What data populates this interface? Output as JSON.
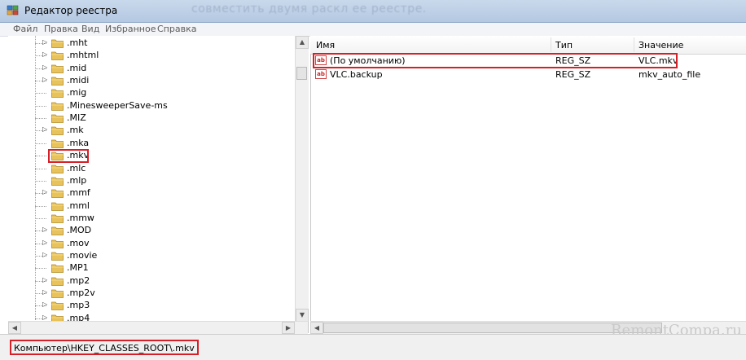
{
  "window": {
    "title": "Редактор реестра",
    "ghost_text": "совместить двумя раскл ее реестре."
  },
  "menu": [
    "Файл",
    "Правка",
    "Вид",
    "Избранное",
    "Справка"
  ],
  "tree": {
    "items": [
      {
        "label": ".mht",
        "expandable": true
      },
      {
        "label": ".mhtml",
        "expandable": true
      },
      {
        "label": ".mid",
        "expandable": true
      },
      {
        "label": ".midi",
        "expandable": true
      },
      {
        "label": ".mig",
        "expandable": false
      },
      {
        "label": ".MinesweeperSave-ms",
        "expandable": false
      },
      {
        "label": ".MIZ",
        "expandable": false
      },
      {
        "label": ".mk",
        "expandable": true
      },
      {
        "label": ".mka",
        "expandable": false
      },
      {
        "label": ".mkv",
        "expandable": false,
        "selected": true
      },
      {
        "label": ".mlc",
        "expandable": false
      },
      {
        "label": ".mlp",
        "expandable": false
      },
      {
        "label": ".mmf",
        "expandable": true
      },
      {
        "label": ".mml",
        "expandable": false
      },
      {
        "label": ".mmw",
        "expandable": false
      },
      {
        "label": ".MOD",
        "expandable": true
      },
      {
        "label": ".mov",
        "expandable": true
      },
      {
        "label": ".movie",
        "expandable": true
      },
      {
        "label": ".MP1",
        "expandable": false
      },
      {
        "label": ".mp2",
        "expandable": true
      },
      {
        "label": ".mp2v",
        "expandable": true
      },
      {
        "label": ".mp3",
        "expandable": true
      },
      {
        "label": ".mp4",
        "expandable": true
      }
    ]
  },
  "values": {
    "columns": {
      "name": "Имя",
      "type": "Тип",
      "value": "Значение"
    },
    "rows": [
      {
        "name": "(По умолчанию)",
        "type": "REG_SZ",
        "value": "VLC.mkv"
      },
      {
        "name": "VLC.backup",
        "type": "REG_SZ",
        "value": "mkv_auto_file"
      }
    ]
  },
  "status": {
    "path": "Компьютер\\HKEY_CLASSES_ROOT\\.mkv"
  },
  "watermark": "RemontCompa.ru",
  "colors": {
    "highlight": "#d61f27",
    "folder": "#e8c25a"
  }
}
